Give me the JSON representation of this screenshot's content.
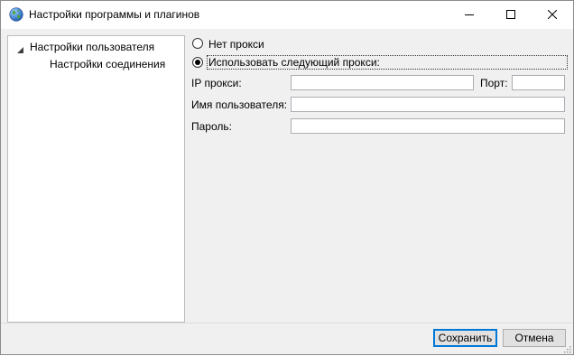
{
  "window": {
    "title": "Настройки программы и плагинов"
  },
  "icons": {
    "app": "globe-icon",
    "minimize": "minimize-icon",
    "maximize": "maximize-icon",
    "close": "close-icon",
    "tree_expand": "triangle-expanded-icon"
  },
  "tree": {
    "items": [
      {
        "label": "Настройки пользователя",
        "expanded": true
      },
      {
        "label": "Настройки соединения",
        "selected": true
      }
    ]
  },
  "proxy": {
    "no_proxy_label": "Нет прокси",
    "no_proxy_checked": false,
    "use_proxy_label": "Использовать следующий прокси:",
    "use_proxy_checked": true,
    "ip_label": "IP прокси:",
    "ip_value": "",
    "port_label": "Порт:",
    "port_value": "",
    "user_label": "Имя пользователя:",
    "user_value": "",
    "password_label": "Пароль:",
    "password_value": ""
  },
  "buttons": {
    "save": "Сохранить",
    "cancel": "Отмена"
  },
  "colors": {
    "focus_border": "#0078d7",
    "panel_bg": "#f0f0f0"
  }
}
